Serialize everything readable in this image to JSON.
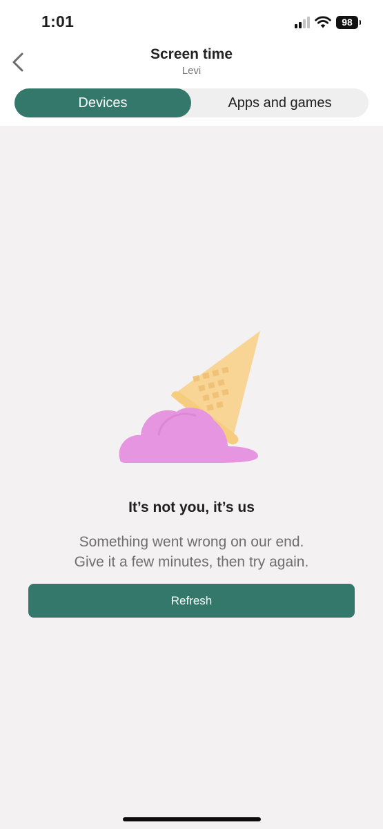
{
  "status_bar": {
    "time": "1:01",
    "battery": "98",
    "signal_icon": "cellular-signal-icon",
    "wifi_icon": "wifi-icon"
  },
  "header": {
    "back_icon": "chevron-left-icon",
    "title": "Screen time",
    "subtitle": "Levi"
  },
  "tabs": [
    {
      "label": "Devices",
      "selected": true
    },
    {
      "label": "Apps and games",
      "selected": false
    }
  ],
  "error": {
    "illustration": "dropped-ice-cream-illustration",
    "heading": "It’s not you, it’s us",
    "message_line1": "Something went wrong on our end.",
    "message_line2": "Give it a few minutes, then try again.",
    "button_label": "Refresh"
  },
  "colors": {
    "accent": "#33786a",
    "background": "#f3f1f2",
    "ice_cream": "#e695e0",
    "cone": "#f8d595"
  }
}
